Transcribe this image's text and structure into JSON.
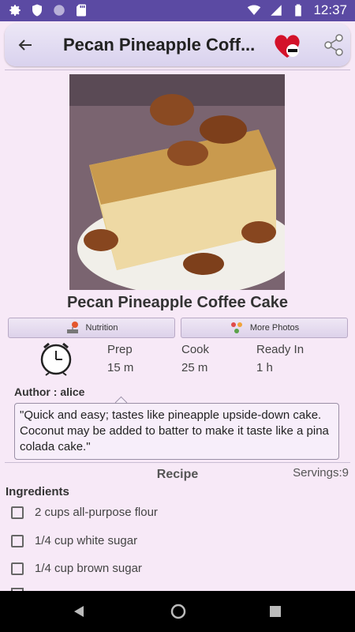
{
  "status_bar": {
    "time": "12:37"
  },
  "app_bar": {
    "title": "Pecan Pineapple Coff..."
  },
  "recipe": {
    "title": "Pecan Pineapple Coffee Cake",
    "nutrition_label": "Nutrition",
    "more_photos_label": "More Photos",
    "times": [
      {
        "label": "Prep",
        "value": "15 m"
      },
      {
        "label": "Cook",
        "value": "25 m"
      },
      {
        "label": "Ready In",
        "value": "1 h"
      }
    ],
    "author": "Author : alice",
    "description": "\"Quick and easy; tastes like pineapple upside-down cake. Coconut may be added to batter to make it taste like a pina colada cake.\"",
    "section_title": "Recipe",
    "servings": "Servings:9",
    "ingredients_title": "Ingredients",
    "ingredients": [
      "2 cups all-purpose flour",
      "1/4 cup white sugar",
      "1/4 cup brown sugar"
    ]
  },
  "colors": {
    "status_bar": "#5b4aa3",
    "background": "#f7e9f7",
    "heart": "#d3122a"
  }
}
